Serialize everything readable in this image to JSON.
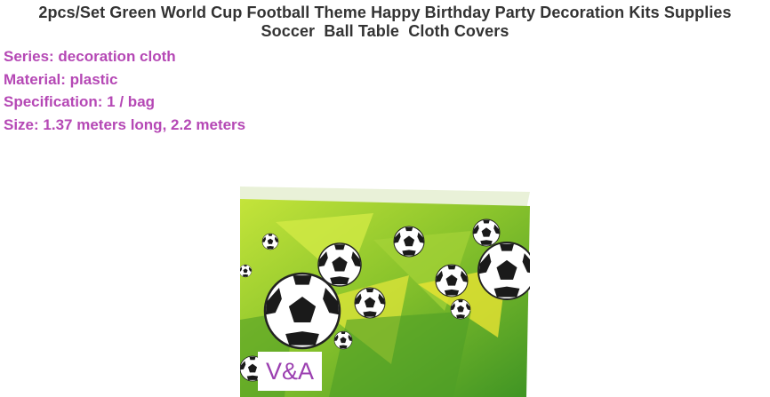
{
  "title": {
    "line1": "2pcs/Set Green World Cup Football Theme Happy Birthday Party Decoration Kits Supplies",
    "line2": "Soccer  Ball Table  Cloth Covers"
  },
  "specs": [
    "Series: decoration cloth",
    "Material: plastic",
    "Specification: 1 / bag",
    "Size: 1.37 meters long, 2.2 meters"
  ],
  "image": {
    "watermark": "V&A",
    "colors": {
      "green_light": "#b5d92e",
      "green_mid": "#7ec02a",
      "green_dark": "#3c8f22",
      "yellow": "#e7e52f"
    }
  }
}
